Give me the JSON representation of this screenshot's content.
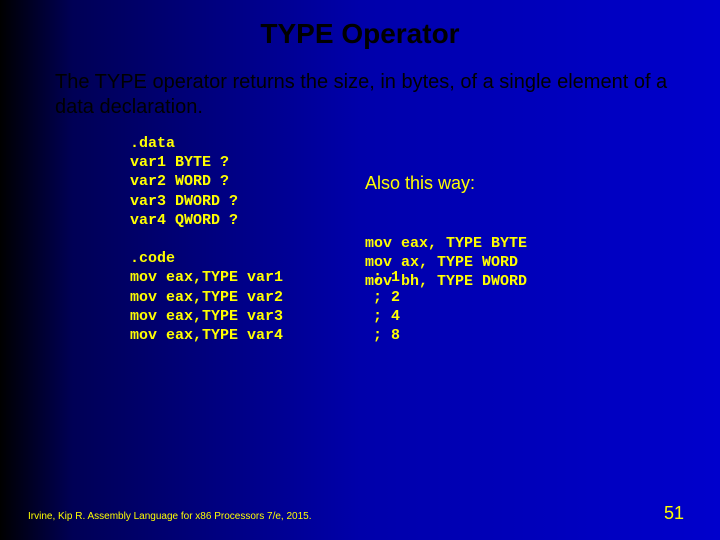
{
  "title": "TYPE Operator",
  "description": "The TYPE operator returns the size, in bytes, of a single element of a data declaration.",
  "code": {
    "data_block": ".data\nvar1 BYTE ?\nvar2 WORD ?\nvar3 DWORD ?\nvar4 QWORD ?",
    "code_block": ".code\nmov eax,TYPE var1          ; 1\nmov eax,TYPE var2          ; 2\nmov eax,TYPE var3          ; 4\nmov eax,TYPE var4          ; 8"
  },
  "aside": {
    "heading": "Also this way:",
    "code": "mov eax, TYPE BYTE\nmov ax, TYPE WORD\nmov bh, TYPE DWORD"
  },
  "footer": {
    "citation": "Irvine, Kip R. Assembly Language for x86 Processors 7/e, 2015.",
    "page": "51"
  }
}
